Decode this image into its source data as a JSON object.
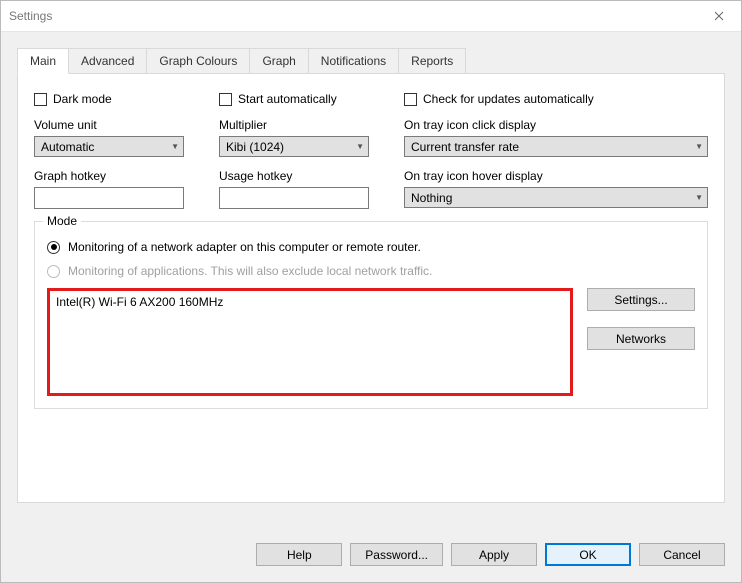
{
  "window": {
    "title": "Settings"
  },
  "tabs": [
    "Main",
    "Advanced",
    "Graph Colours",
    "Graph",
    "Notifications",
    "Reports"
  ],
  "active_tab": 0,
  "checks": {
    "dark_mode": "Dark mode",
    "start_auto": "Start automatically",
    "check_updates": "Check for updates automatically"
  },
  "labels": {
    "volume_unit": "Volume unit",
    "multiplier": "Multiplier",
    "tray_click": "On tray icon click display",
    "graph_hotkey": "Graph hotkey",
    "usage_hotkey": "Usage hotkey",
    "tray_hover": "On tray icon hover display",
    "mode": "Mode"
  },
  "selects": {
    "volume_unit": "Automatic",
    "multiplier": "Kibi (1024)",
    "tray_click": "Current transfer rate",
    "tray_hover": "Nothing"
  },
  "inputs": {
    "graph_hotkey": "",
    "usage_hotkey": ""
  },
  "mode": {
    "radio_adapter": "Monitoring of a network adapter on this computer or remote router.",
    "radio_apps": "Monitoring of applications. This will also exclude local network traffic.",
    "adapter": "Intel(R) Wi-Fi 6 AX200 160MHz",
    "settings_btn": "Settings...",
    "networks_btn": "Networks"
  },
  "buttons": {
    "help": "Help",
    "password": "Password...",
    "apply": "Apply",
    "ok": "OK",
    "cancel": "Cancel"
  }
}
